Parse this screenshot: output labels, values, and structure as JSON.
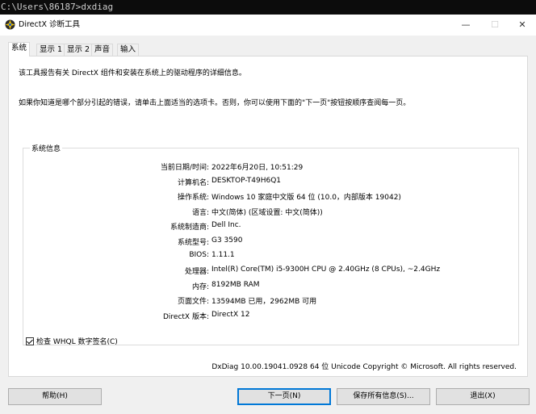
{
  "console": {
    "text": "C:\\Users\\86187>dxdiag"
  },
  "window": {
    "title": "DirectX 诊断工具",
    "minimize": "—",
    "maximize": "☐",
    "close": "✕"
  },
  "tabs": [
    {
      "label": "系统"
    },
    {
      "label": "显示 1"
    },
    {
      "label": "显示 2"
    },
    {
      "label": "声音"
    },
    {
      "label": "输入"
    }
  ],
  "intro": {
    "line1": "该工具报告有关 DirectX 组件和安装在系统上的驱动程序的详细信息。",
    "line2": "如果你知道是哪个部分引起的错误，请单击上面适当的选项卡。否则，你可以使用下面的\"下一页\"按钮按顺序查阅每一页。"
  },
  "system_info": {
    "title": "系统信息",
    "rows": [
      {
        "label": "当前日期/时间:",
        "value": "2022年6月20日, 10:51:29"
      },
      {
        "label": "计算机名:",
        "value": "DESKTOP-T49H6Q1"
      },
      {
        "label": "操作系统:",
        "value": "Windows 10 家庭中文版 64 位 (10.0，内部版本 19042)"
      },
      {
        "label": "语言:",
        "value": "中文(简体) (区域设置: 中文(简体))"
      },
      {
        "label": "系统制造商:",
        "value": "Dell Inc."
      },
      {
        "label": "系统型号:",
        "value": "G3 3590"
      },
      {
        "label": "BIOS:",
        "value": "1.11.1"
      },
      {
        "label": "处理器:",
        "value": "Intel(R) Core(TM) i5-9300H CPU @ 2.40GHz (8 CPUs), ~2.4GHz"
      },
      {
        "label": "内存:",
        "value": "8192MB RAM"
      },
      {
        "label": "页面文件:",
        "value": "13594MB 已用，2962MB 可用"
      },
      {
        "label": "DirectX 版本:",
        "value": "DirectX 12"
      }
    ]
  },
  "whql": {
    "label": "检查 WHQL 数字签名(C)",
    "checked": true
  },
  "footer": "DxDiag 10.00.19041.0928 64 位 Unicode  Copyright © Microsoft. All rights reserved.",
  "buttons": {
    "help": "帮助(H)",
    "next": "下一页(N)",
    "save": "保存所有信息(S)...",
    "exit": "退出(X)"
  }
}
